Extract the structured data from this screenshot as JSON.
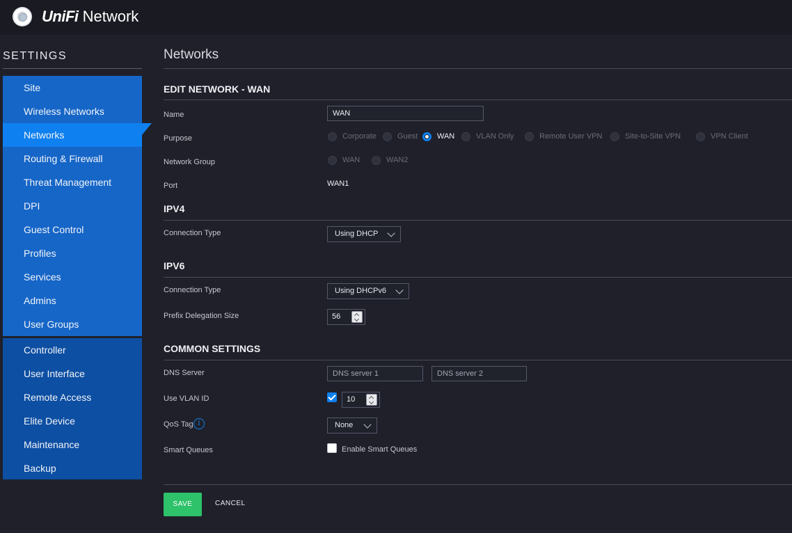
{
  "app": {
    "brand_bold": "UniFi",
    "brand_rest": " Network"
  },
  "sidebar": {
    "title": "SETTINGS",
    "groups": [
      {
        "items": [
          "Site",
          "Wireless Networks",
          "Networks",
          "Routing & Firewall",
          "Threat Management",
          "DPI",
          "Guest Control",
          "Profiles",
          "Services",
          "Admins",
          "User Groups"
        ]
      },
      {
        "items": [
          "Controller",
          "User Interface",
          "Remote Access",
          "Elite Device",
          "Maintenance",
          "Backup"
        ]
      }
    ],
    "active": "Networks"
  },
  "main": {
    "page_title": "Networks",
    "edit_title": "EDIT NETWORK - WAN",
    "name_label": "Name",
    "name_value": "WAN",
    "purpose_label": "Purpose",
    "purpose_options": [
      "Corporate",
      "Guest",
      "WAN",
      "VLAN Only",
      "Remote User VPN",
      "Site-to-Site VPN",
      "VPN Client"
    ],
    "purpose_selected": "WAN",
    "network_group_label": "Network Group",
    "network_group_options": [
      "WAN",
      "WAN2"
    ],
    "port_label": "Port",
    "port_value": "WAN1",
    "ipv4_title": "IPV4",
    "ipv4_conn_label": "Connection Type",
    "ipv4_conn_value": "Using DHCP",
    "ipv6_title": "IPV6",
    "ipv6_conn_label": "Connection Type",
    "ipv6_conn_value": "Using DHCPv6",
    "prefix_label": "Prefix Delegation Size",
    "prefix_value": "56",
    "common_title": "COMMON SETTINGS",
    "dns_label": "DNS Server",
    "dns1_placeholder": "DNS server 1",
    "dns2_placeholder": "DNS server 2",
    "vlan_label": "Use VLAN ID",
    "vlan_checked": true,
    "vlan_value": "10",
    "qos_label": "QoS Tag",
    "qos_value": "None",
    "smart_label": "Smart Queues",
    "smart_checkbox_label": "Enable Smart Queues",
    "smart_checked": false,
    "save_label": "SAVE",
    "cancel_label": "CANCEL"
  },
  "colors": {
    "accent": "#0f80f0",
    "save": "#2ec26a",
    "sidebar": "#1666c8"
  }
}
